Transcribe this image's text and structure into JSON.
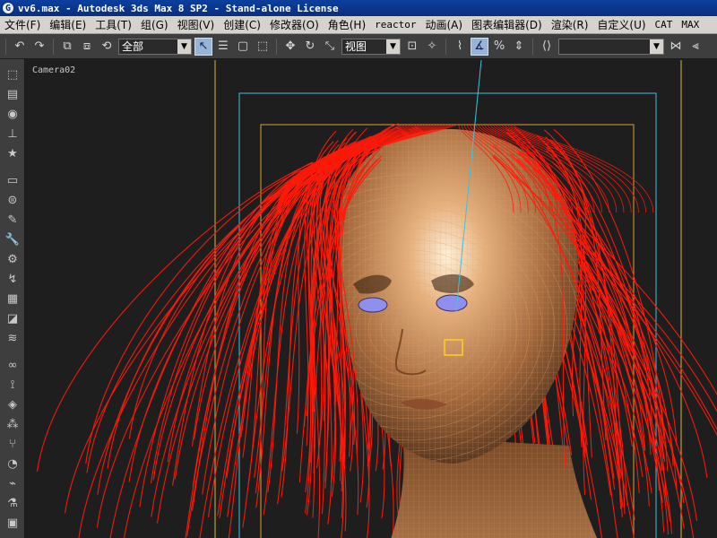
{
  "window": {
    "title": "vv6.max - Autodesk 3ds Max 8 SP2  - Stand-alone License"
  },
  "menu": [
    {
      "label": "文件(F)",
      "latin": false
    },
    {
      "label": "编辑(E)",
      "latin": false
    },
    {
      "label": "工具(T)",
      "latin": false
    },
    {
      "label": "组(G)",
      "latin": false
    },
    {
      "label": "视图(V)",
      "latin": false
    },
    {
      "label": "创建(C)",
      "latin": false
    },
    {
      "label": "修改器(O)",
      "latin": false
    },
    {
      "label": "角色(H)",
      "latin": false
    },
    {
      "label": "reactor",
      "latin": true
    },
    {
      "label": "动画(A)",
      "latin": false
    },
    {
      "label": "图表编辑器(D)",
      "latin": false
    },
    {
      "label": "渲染(R)",
      "latin": false
    },
    {
      "label": "自定义(U)",
      "latin": false
    },
    {
      "label": "CAT",
      "latin": true
    },
    {
      "label": "MAX",
      "latin": true
    }
  ],
  "toolbar": {
    "selection_filter": "全部",
    "reference_coord": "视图",
    "named_selection": ""
  },
  "viewport": {
    "label": "Camera02"
  },
  "colors": {
    "hair": "#ff1a0a",
    "skin": "#c08a5c",
    "wire": "#e8a060",
    "eyes": "#8f8fee",
    "safe_frame_outer": "#d9b63a",
    "safe_frame_action": "#3ec3d8",
    "safe_frame_title": "#d9a23a"
  }
}
